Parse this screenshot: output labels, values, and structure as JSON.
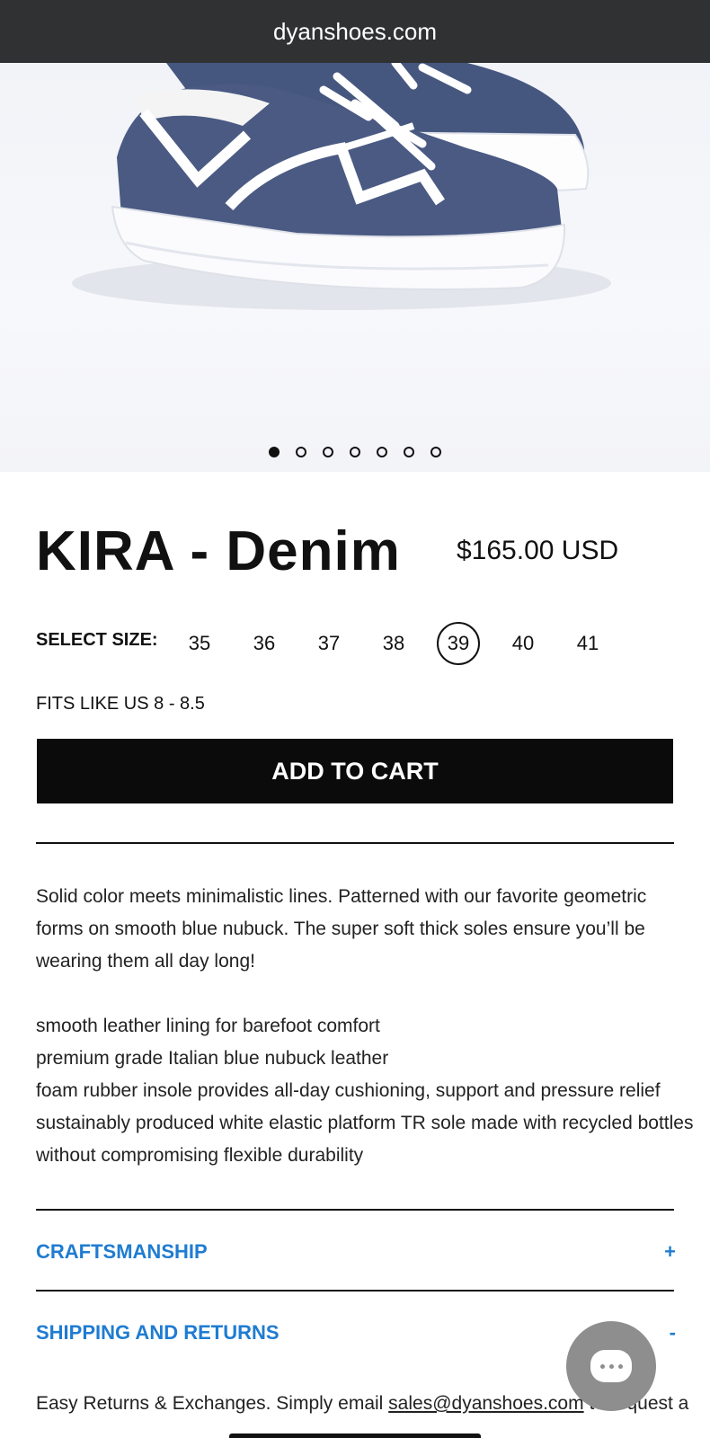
{
  "browser": {
    "url": "dyanshoes.com"
  },
  "gallery": {
    "slide_count": 7,
    "active_index": 0,
    "image_alt": "denim-sneaker-product-image"
  },
  "product": {
    "title": "KIRA - Denim",
    "price": "$165.00 USD",
    "size_label": "SELECT SIZE:",
    "sizes": [
      "35",
      "36",
      "37",
      "38",
      "39",
      "40",
      "41"
    ],
    "selected_size": "39",
    "fit_note": "FITS LIKE US 8 - 8.5",
    "add_to_cart": "ADD TO CART"
  },
  "description": {
    "paragraph": "Solid color meets minimalistic lines. Patterned with our favorite geometric forms on smooth blue nubuck. The super soft thick soles ensure you’ll be wearing them all day long!",
    "features": [
      "smooth leather lining for barefoot comfort",
      "premium grade Italian blue nubuck leather",
      "foam rubber insole provides all-day cushioning, support and pressure relief",
      "sustainably produced white elastic platform TR sole made with recycled bottles",
      "without compromising flexible durability"
    ]
  },
  "accordions": [
    {
      "label": "CRAFTSMANSHIP",
      "sign": "+"
    },
    {
      "label": "SHIPPING AND RETURNS",
      "sign": "-"
    }
  ],
  "returns": {
    "text_before": "Easy Returns & Exchanges. Simply email ",
    "email": "sales@dyanshoes.com",
    "text_after": " to request a"
  },
  "colors": {
    "accent": "#1f7cd1",
    "button": "#0b0b0c",
    "urlbar": "#2f3133"
  }
}
